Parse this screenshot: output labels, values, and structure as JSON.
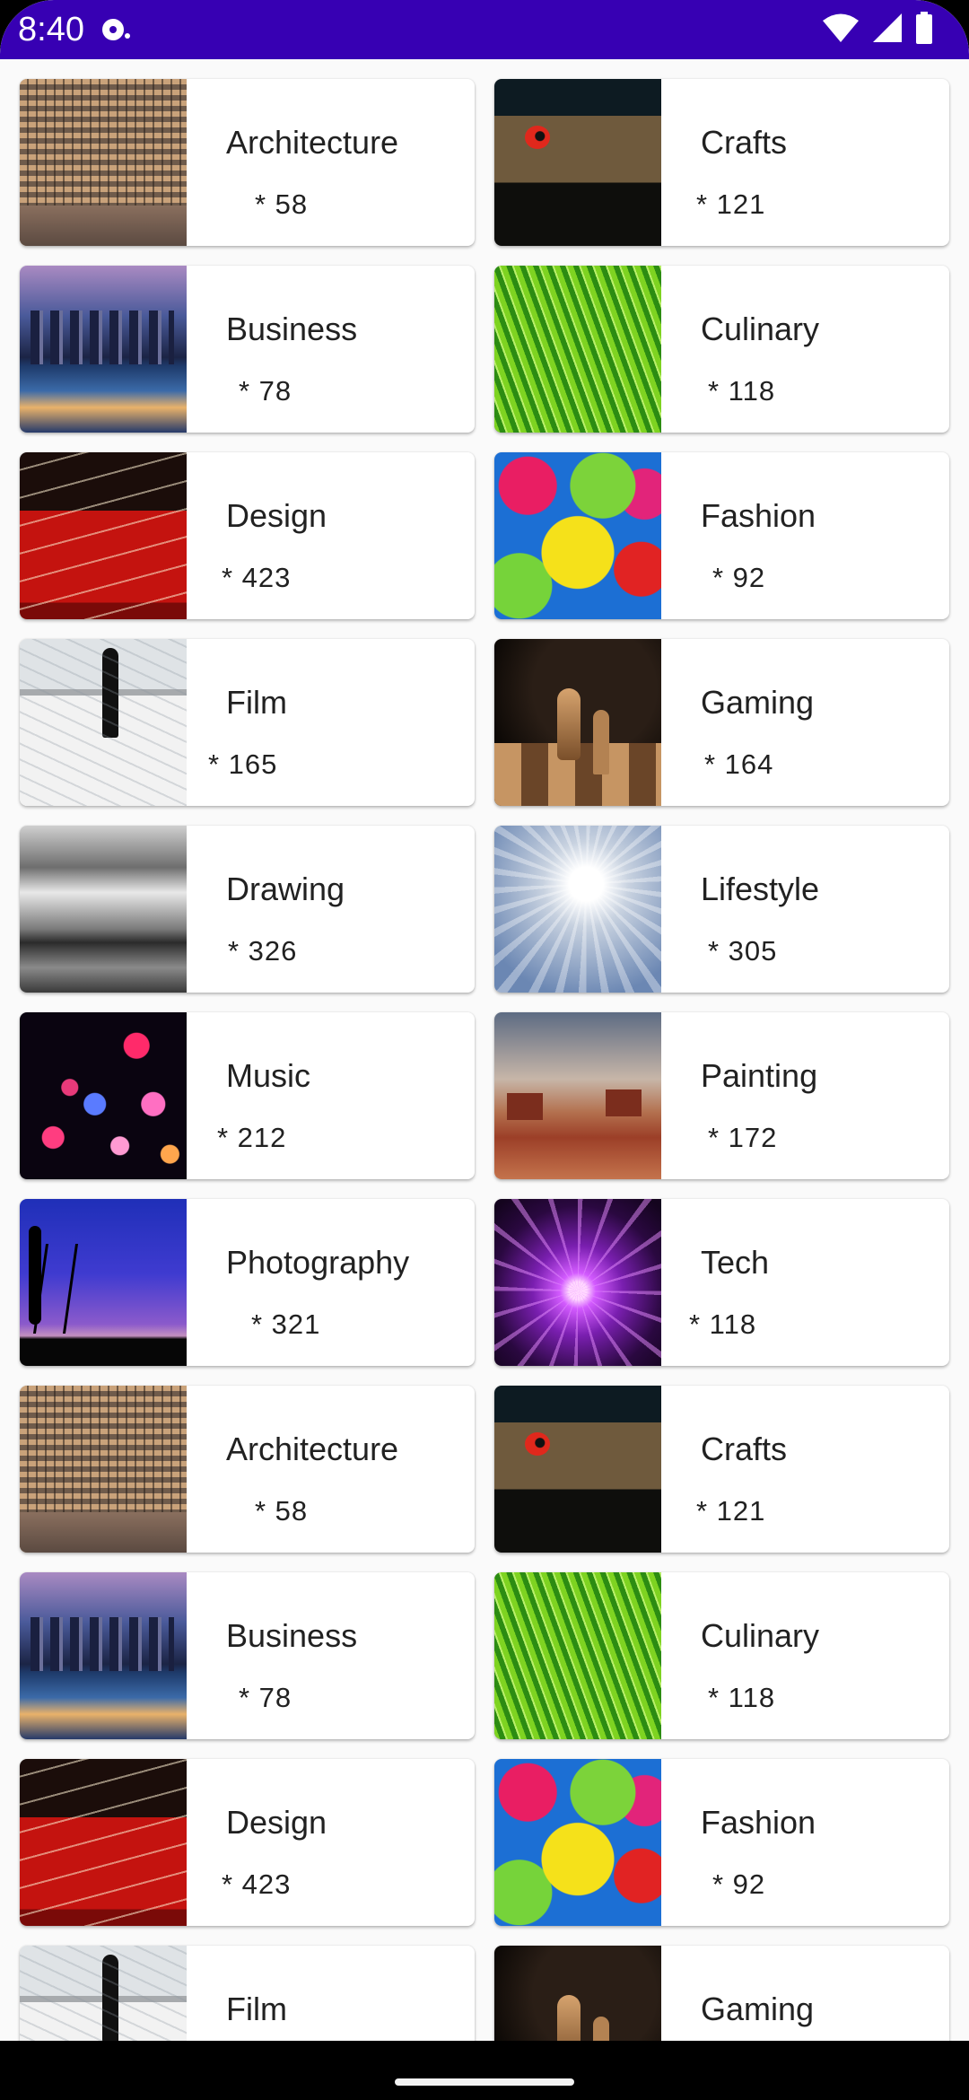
{
  "status_bar": {
    "time": "8:40",
    "colors": {
      "background": "#3700B3",
      "foreground": "#FFFFFF"
    },
    "icons": [
      "notification-icon",
      "wifi-icon",
      "cellular-signal-icon",
      "battery-icon"
    ]
  },
  "topics": [
    {
      "name": "Architecture",
      "count_text": "*  58",
      "thumbnail": "office-building-facade"
    },
    {
      "name": "Crafts",
      "count_text": "*  121",
      "thumbnail": "bird-in-bamboo-birdhouse"
    },
    {
      "name": "Business",
      "count_text": "*  78",
      "thumbnail": "city-skyline-at-dusk"
    },
    {
      "name": "Culinary",
      "count_text": "*  118",
      "thumbnail": "green-grass-closeup"
    },
    {
      "name": "Design",
      "count_text": "*  423",
      "thumbnail": "red-car-light-trails"
    },
    {
      "name": "Fashion",
      "count_text": "*  92",
      "thumbnail": "colorful-umbrellas"
    },
    {
      "name": "Film",
      "count_text": "*  165",
      "thumbnail": "person-on-salt-flats"
    },
    {
      "name": "Gaming",
      "count_text": "*  164",
      "thumbnail": "chess-pieces"
    },
    {
      "name": "Drawing",
      "count_text": "*  326",
      "thumbnail": "clouds-over-canyon-bw"
    },
    {
      "name": "Lifestyle",
      "count_text": "*  305",
      "thumbnail": "skier-in-snow"
    },
    {
      "name": "Music",
      "count_text": "*  212",
      "thumbnail": "bokeh-lights"
    },
    {
      "name": "Painting",
      "count_text": "*  172",
      "thumbnail": "desert-buttes"
    },
    {
      "name": "Photography",
      "count_text": "*  321",
      "thumbnail": "photographer-silhouette-sunset"
    },
    {
      "name": "Tech",
      "count_text": "*  118",
      "thumbnail": "plasma-ball"
    },
    {
      "name": "Architecture",
      "count_text": "*  58",
      "thumbnail": "office-building-facade"
    },
    {
      "name": "Crafts",
      "count_text": "*  121",
      "thumbnail": "bird-in-bamboo-birdhouse"
    },
    {
      "name": "Business",
      "count_text": "*  78",
      "thumbnail": "city-skyline-at-dusk"
    },
    {
      "name": "Culinary",
      "count_text": "*  118",
      "thumbnail": "green-grass-closeup"
    },
    {
      "name": "Design",
      "count_text": "*  423",
      "thumbnail": "red-car-light-trails"
    },
    {
      "name": "Fashion",
      "count_text": "*  92",
      "thumbnail": "colorful-umbrellas"
    },
    {
      "name": "Film",
      "count_text": "",
      "thumbnail": "person-on-salt-flats"
    },
    {
      "name": "Gaming",
      "count_text": "",
      "thumbnail": "chess-pieces"
    }
  ]
}
